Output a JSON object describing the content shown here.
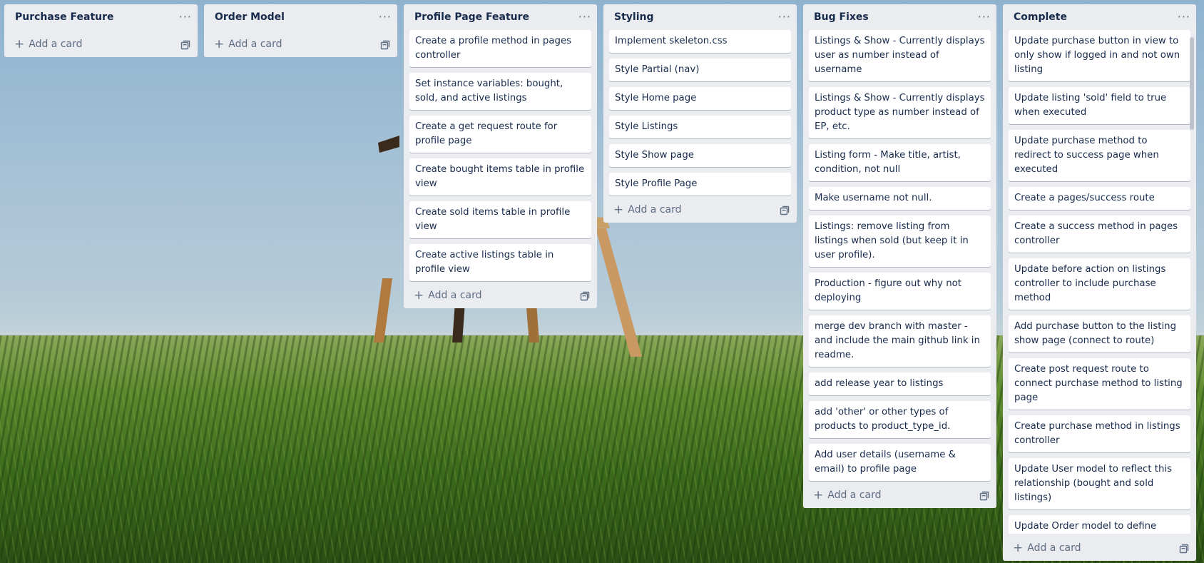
{
  "lists": [
    {
      "title": "Purchase Feature",
      "cards": [],
      "add_label": "Add a card"
    },
    {
      "title": "Order Model",
      "cards": [],
      "add_label": "Add a card"
    },
    {
      "title": "Profile Page Feature",
      "add_label": "Add a card",
      "cards": [
        "Create a profile method in pages controller",
        "Set instance variables: bought, sold, and active listings",
        "Create a get request route for profile page",
        "Create bought items table in profile view",
        "Create sold items table in profile view",
        "Create active listings table in profile view"
      ]
    },
    {
      "title": "Styling",
      "add_label": "Add a card",
      "cards": [
        "Implement skeleton.css",
        "Style Partial (nav)",
        "Style Home page",
        "Style Listings",
        "Style Show page",
        "Style Profile Page"
      ]
    },
    {
      "title": "Bug Fixes",
      "add_label": "Add a card",
      "cards": [
        "Listings & Show - Currently displays user as number instead of username",
        "Listings & Show - Currently displays product type as number instead of EP, etc.",
        "Listing form - Make title, artist, condition, not null",
        "Make username not null.",
        "Listings: remove listing from listings when sold (but keep it in user profile).",
        "Production - figure out why not deploying",
        "merge dev branch with master - and include the main github link in readme.",
        "add release year to listings",
        "add 'other' or other types of products to product_type_id.",
        "Add user details (username & email) to profile page"
      ]
    },
    {
      "title": "Complete",
      "add_label": "Add a card",
      "cards": [
        "Update purchase button in view to only show if logged in and not own listing",
        "Update listing 'sold' field to true when executed",
        "Update purchase method to redirect to success page when executed",
        "Create a pages/success route",
        "Create a success method in pages controller",
        "Update before action on listings controller to include purchase method",
        "Add purchase button to the listing show page (connect to route)",
        "Create post request route to connect purchase method to listing page",
        "Create purchase method in listings controller",
        "Update User model to reflect this relationship (bought and sold listings)",
        "Update Order model to define association between Order and Buyer & Seller"
      ]
    }
  ],
  "icons": {
    "menu": "ellipsis-icon",
    "add": "plus-icon",
    "template": "card-template-icon"
  },
  "colors": {
    "list_bg": "#ebecf0",
    "card_bg": "#ffffff",
    "text": "#172b4d",
    "muted": "#5e6c84"
  }
}
